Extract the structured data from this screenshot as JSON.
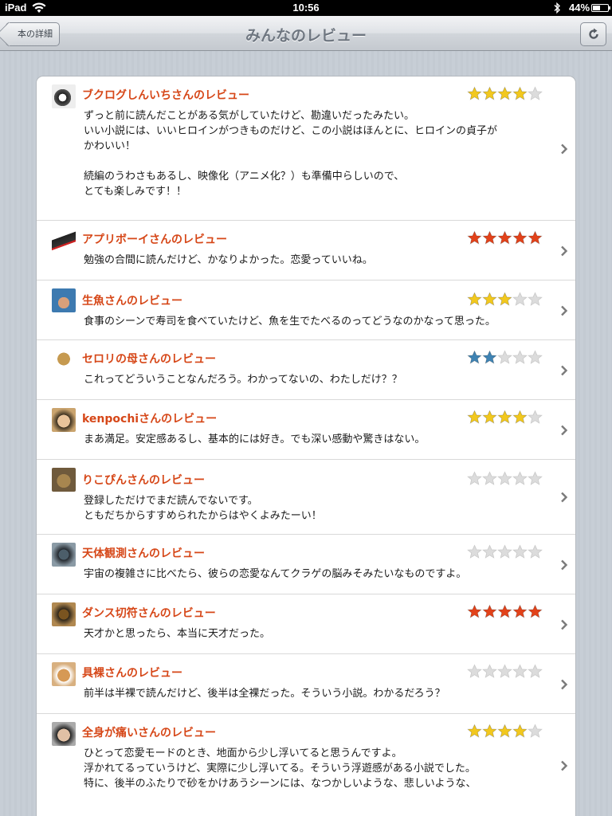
{
  "status_bar": {
    "device": "iPad",
    "time": "10:56",
    "battery": "44%",
    "battery_level": 0.44
  },
  "nav": {
    "back_label": "本の詳細",
    "title": "みんなのレビュー"
  },
  "colors": {
    "title_red": "#d64718",
    "star_gold": "#f2c81e",
    "star_red": "#e2421a",
    "star_blue": "#3f83b3",
    "star_empty": "#dcdcdc"
  },
  "reviews": [
    {
      "title": "ブクログしんいちさんのレビュー",
      "rating": 4,
      "star_color": "gold",
      "body": "ずっと前に読んだことがある気がしていたけど、勘違いだったみたい。\nいい小説には、いいヒロインがつきものだけど、この小説はほんとに、ヒロインの貞子が\nかわいい！\n\n続編のうわさもあるし、映像化（アニメ化？）も準備中らしいので、\nとても楽しみです！！",
      "avatar": "hedgehog-avatar"
    },
    {
      "title": "アプリボーイさんのレビュー",
      "rating": 5,
      "star_color": "red",
      "body": "勉強の合間に読んだけど、かなりよかった。恋愛っていいね。",
      "avatar": "sneaker-avatar"
    },
    {
      "title": "生魚さんのレビュー",
      "rating": 3,
      "star_color": "gold",
      "body": "食事のシーンで寿司を食べていたけど、魚を生でたべるのってどうなのかなって思った。",
      "avatar": "person-avatar"
    },
    {
      "title": "セロリの母さんのレビュー",
      "rating": 2,
      "star_color": "blue",
      "body": "これってどういうことなんだろう。わかってないの、わたしだけ？？",
      "avatar": "drawing-avatar"
    },
    {
      "title": "kenpochiさんのレビュー",
      "rating": 4,
      "star_color": "gold",
      "body": "まあ満足。安定感あるし、基本的には好き。でも深い感動や驚きはない。",
      "avatar": "face-avatar"
    },
    {
      "title": "りこぴんさんのレビュー",
      "rating": 0,
      "star_color": "gold",
      "body": "登録しただけでまだ読んでないです。\nともだちからすすめられたからはやくよみたーい！",
      "avatar": "dog-avatar"
    },
    {
      "title": "天体観測さんのレビュー",
      "rating": 0,
      "star_color": "gold",
      "body": "宇宙の複雑さに比べたら、彼らの恋愛なんてクラゲの脳みそみたいなものですよ。",
      "avatar": "person2-avatar"
    },
    {
      "title": "ダンス切符さんのレビュー",
      "rating": 5,
      "star_color": "red",
      "body": "天才かと思ったら、本当に天才だった。",
      "avatar": "owl-avatar"
    },
    {
      "title": "具裸さんのレビュー",
      "rating": 0,
      "star_color": "gold",
      "body": "前半は半裸で読んだけど、後半は全裸だった。そういう小説。わかるだろう？",
      "avatar": "corgi-avatar"
    },
    {
      "title": "全身が痛いさんのレビュー",
      "rating": 4,
      "star_color": "gold",
      "body": "ひとって恋愛モードのとき、地面から少し浮いてると思うんですよ。\n浮かれてるっていうけど、実際に少し浮いてる。そういう浮遊感がある小説でした。\n特に、後半のふたりで砂をかけあうシーンには、なつかしいような、悲しいような、",
      "avatar": "glasses-avatar"
    }
  ]
}
